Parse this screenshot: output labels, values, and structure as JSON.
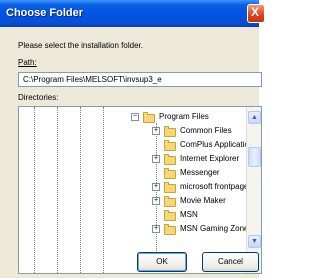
{
  "window": {
    "title": "Choose Folder",
    "close_symbol": "X"
  },
  "labels": {
    "instruction": "Please select the installation folder.",
    "path": "Path:",
    "directories": "Directories:"
  },
  "path_value": "C:\\Program Files\\MELSOFT\\invsup3_e",
  "tree": {
    "parent": {
      "label": "Program Files",
      "expander": "−"
    },
    "items": [
      {
        "label": "Common Files",
        "expander": "+"
      },
      {
        "label": "ComPlus Applications",
        "expander": ""
      },
      {
        "label": "Internet Explorer",
        "expander": "+"
      },
      {
        "label": "Messenger",
        "expander": ""
      },
      {
        "label": "microsoft frontpage",
        "expander": "+"
      },
      {
        "label": "Movie Maker",
        "expander": "+"
      },
      {
        "label": "MSN",
        "expander": ""
      },
      {
        "label": "MSN Gaming Zone",
        "expander": "+"
      }
    ]
  },
  "scrollbar": {
    "up": "▲",
    "down": "▼"
  },
  "buttons": {
    "ok": "OK",
    "cancel": "Cancel"
  }
}
